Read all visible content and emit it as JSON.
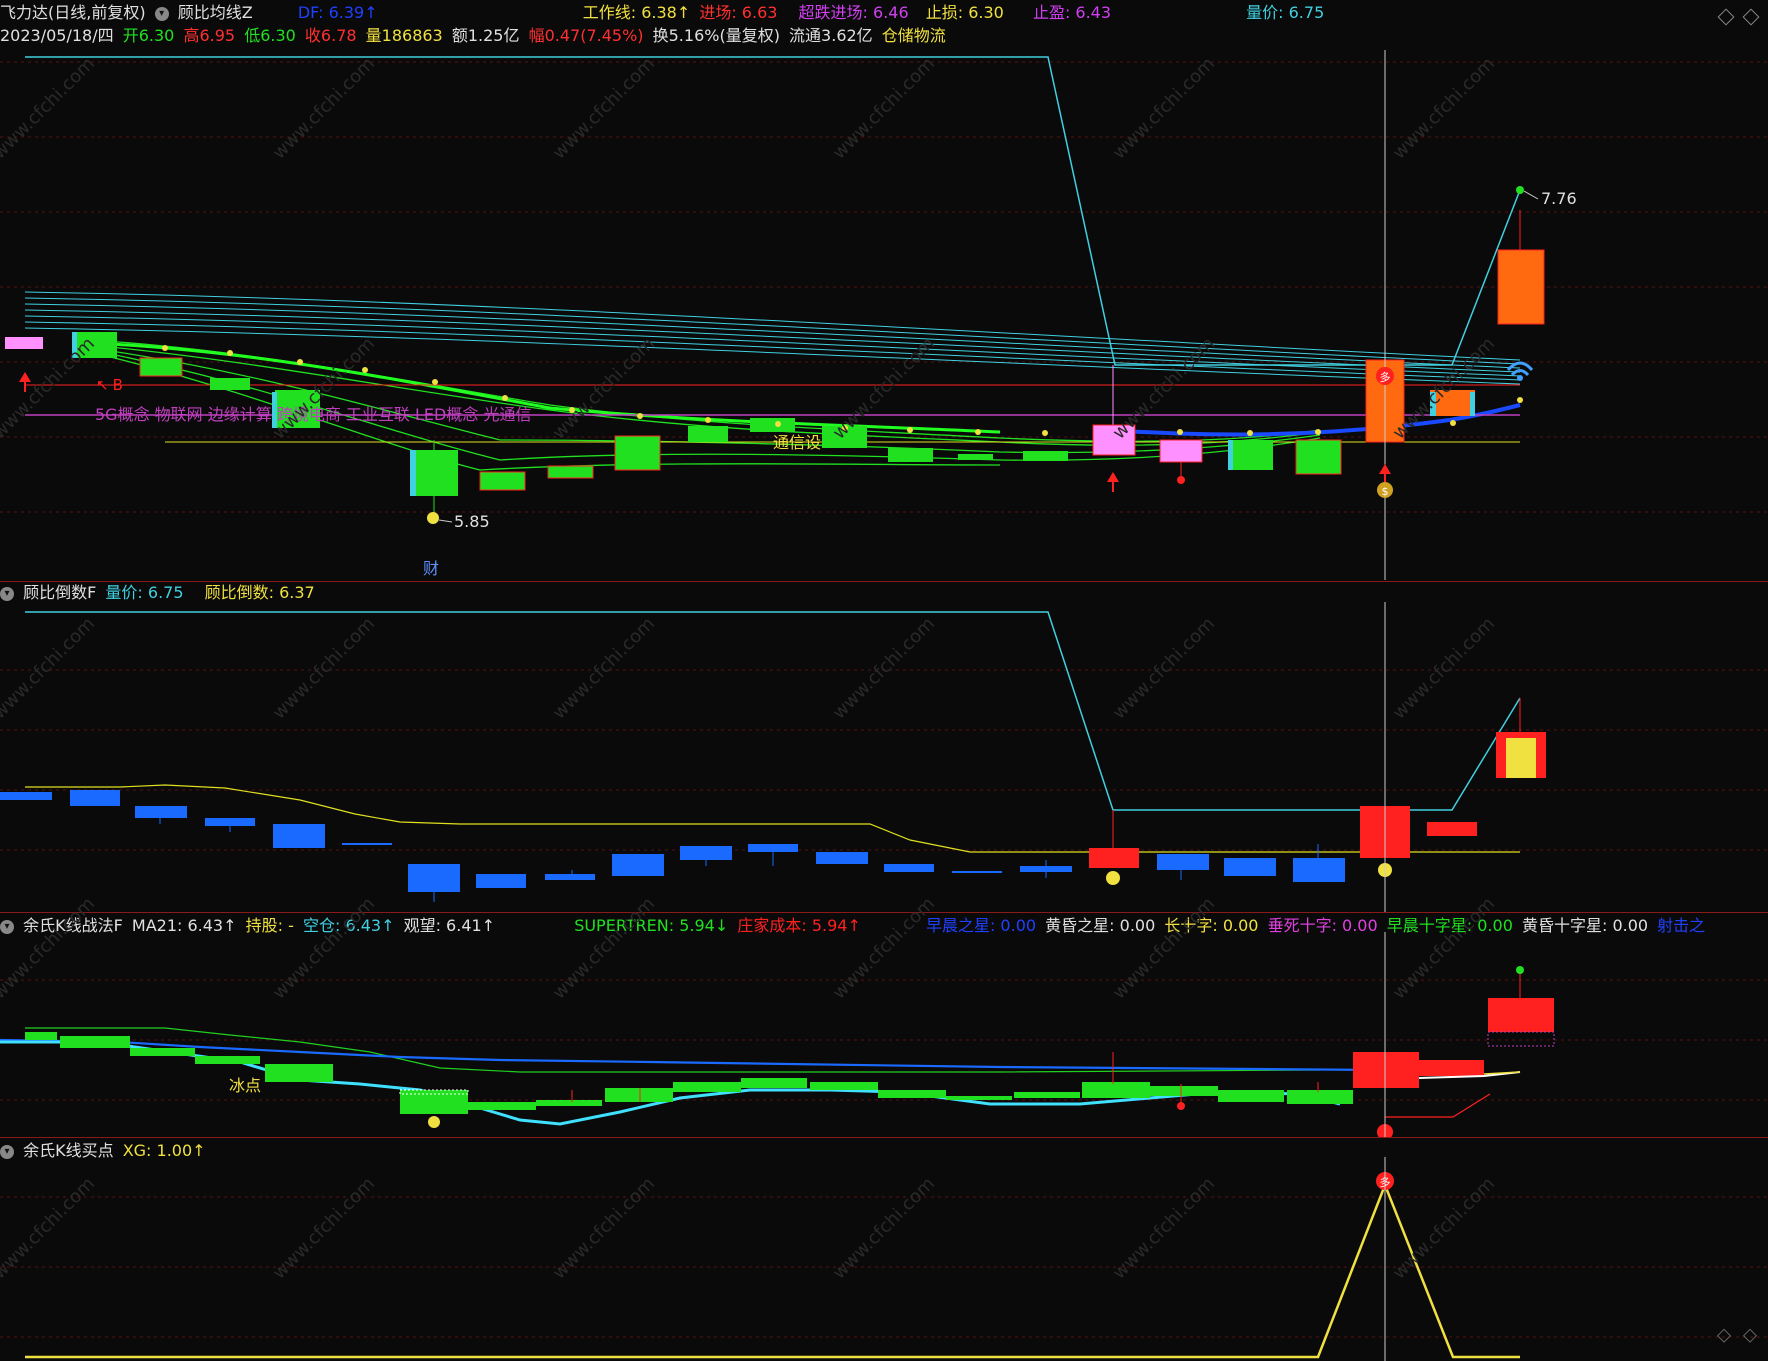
{
  "header": {
    "title": "飞力达(日线,前复权)",
    "indicator": "顾比均线Z",
    "df": "DF: 6.39↑",
    "work_line": "工作线: 6.38↑",
    "entry": "进场: 6.63",
    "oversold_entry": "超跌进场: 6.46",
    "stop_loss": "止损: 6.30",
    "take_profit": "止盈: 6.43",
    "vol_price": "量价: 6.75"
  },
  "quote": {
    "date": "2023/05/18/四",
    "open": "开6.30",
    "high": "高6.95",
    "low": "低6.30",
    "close": "收6.78",
    "volume": "量186863",
    "amount": "额1.25亿",
    "change": "幅0.47(7.45%)",
    "turnover": "换5.16%(量复权)",
    "float": "流通3.62亿",
    "sector": "仓储物流"
  },
  "main_chart": {
    "concept_text": "5G概念 物联网 边缘计算 跨境电商 工业互联 LED概念 光通信",
    "sector_text": "通信设",
    "b_label": "B",
    "high_label": "7.76",
    "low_label": "5.85",
    "cai_label": "财"
  },
  "pane2": {
    "name": "顾比倒数F",
    "vol_price": "量价: 6.75",
    "countdown": "顾比倒数: 6.37"
  },
  "pane3": {
    "name": "余氏K线战法F",
    "ma21": "MA21: 6.43↑",
    "hold": "持股: -",
    "empty": "空仓: 6.43↑",
    "watch": "观望: 6.41↑",
    "supertrend": "SUPERTREN: 5.94↓",
    "dealer_cost": "庄家成本: 5.94↑",
    "morning_star": "早晨之星: 0.00",
    "evening_star": "黄昏之星: 0.00",
    "long_cross": "长十字: 0.00",
    "death_cross": "垂死十字: 0.00",
    "morning_cross": "早晨十字星: 0.00",
    "evening_cross": "黄昏十字星: 0.00",
    "shooting": "射击之",
    "ice_label": "冰点"
  },
  "pane4": {
    "name": "余氏K线买点",
    "xg": "XG: 1.00↑"
  },
  "watermark": "www.cfchi.com",
  "colors": {
    "up": "#ff2020",
    "down": "#00dd00",
    "cyan": "#40d0e0",
    "yellow": "#f0e040",
    "magenta": "#e040e0",
    "blue": "#1a6aff"
  }
}
